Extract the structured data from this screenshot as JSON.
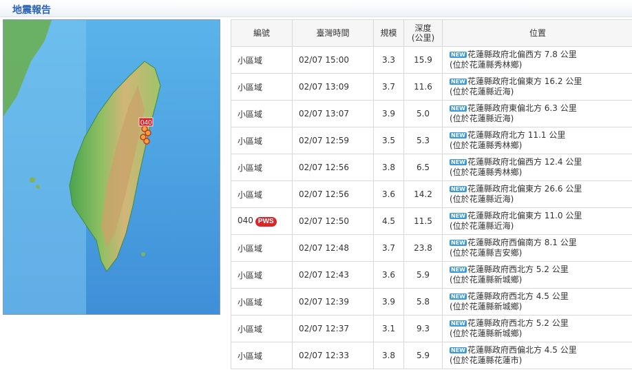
{
  "header": {
    "title": "地震報告"
  },
  "map": {
    "marker_label": "040",
    "sea_color": "#4f9fe0",
    "land_color": "#c8a869"
  },
  "table": {
    "headers": {
      "id": "編號",
      "time": "臺灣時間",
      "magnitude": "規模",
      "depth": "深度\n(公里)",
      "location": "位置"
    },
    "new_badge": "NEW",
    "rows": [
      {
        "id": "小區域",
        "time": "02/07 15:00",
        "magnitude": "3.3",
        "depth": "15.9",
        "loc_main": "花蓮縣政府北偏西方 7.8 公里",
        "loc_sub": "(位於花蓮縣秀林鄉)"
      },
      {
        "id": "小區域",
        "time": "02/07 13:09",
        "magnitude": "3.7",
        "depth": "11.6",
        "loc_main": "花蓮縣政府北偏東方 16.2 公里",
        "loc_sub": "(位於花蓮縣近海)"
      },
      {
        "id": "小區域",
        "time": "02/07 13:07",
        "magnitude": "3.9",
        "depth": "5.0",
        "loc_main": "花蓮縣政府東偏北方 6.3 公里",
        "loc_sub": "(位於花蓮縣近海)"
      },
      {
        "id": "小區域",
        "time": "02/07 12:59",
        "magnitude": "3.5",
        "depth": "5.3",
        "loc_main": "花蓮縣政府北方 11.1 公里",
        "loc_sub": "(位於花蓮縣秀林鄉)"
      },
      {
        "id": "小區域",
        "time": "02/07 12:56",
        "magnitude": "3.8",
        "depth": "6.5",
        "loc_main": "花蓮縣政府北偏西方 12.4 公里",
        "loc_sub": "(位於花蓮縣秀林鄉)"
      },
      {
        "id": "小區域",
        "time": "02/07 12:56",
        "magnitude": "3.6",
        "depth": "14.2",
        "loc_main": "花蓮縣政府北偏東方 26.6 公里",
        "loc_sub": "(位於花蓮縣近海)"
      },
      {
        "id": "040",
        "badge": "PWS",
        "time": "02/07 12:50",
        "magnitude": "4.5",
        "depth": "11.5",
        "loc_main": "花蓮縣政府北偏東方 11.0 公里",
        "loc_sub": "(位於花蓮縣近海)"
      },
      {
        "id": "小區域",
        "time": "02/07 12:48",
        "magnitude": "3.7",
        "depth": "23.8",
        "loc_main": "花蓮縣政府西偏南方 8.1 公里",
        "loc_sub": "(位於花蓮縣吉安鄉)"
      },
      {
        "id": "小區域",
        "time": "02/07 12:43",
        "magnitude": "3.6",
        "depth": "5.9",
        "loc_main": "花蓮縣政府西北方 5.2 公里",
        "loc_sub": "(位於花蓮縣新城鄉)"
      },
      {
        "id": "小區域",
        "time": "02/07 12:39",
        "magnitude": "3.9",
        "depth": "5.8",
        "loc_main": "花蓮縣政府西北方 4.5 公里",
        "loc_sub": "(位於花蓮縣新城鄉)"
      },
      {
        "id": "小區域",
        "time": "02/07 12:37",
        "magnitude": "3.1",
        "depth": "9.3",
        "loc_main": "花蓮縣政府西北方 5.2 公里",
        "loc_sub": "(位於花蓮縣新城鄉)"
      },
      {
        "id": "小區域",
        "time": "02/07 12:33",
        "magnitude": "3.8",
        "depth": "5.9",
        "loc_main": "花蓮縣政府西偏北方 4.5 公里",
        "loc_sub": "(位於花蓮縣花蓮市)"
      }
    ]
  }
}
